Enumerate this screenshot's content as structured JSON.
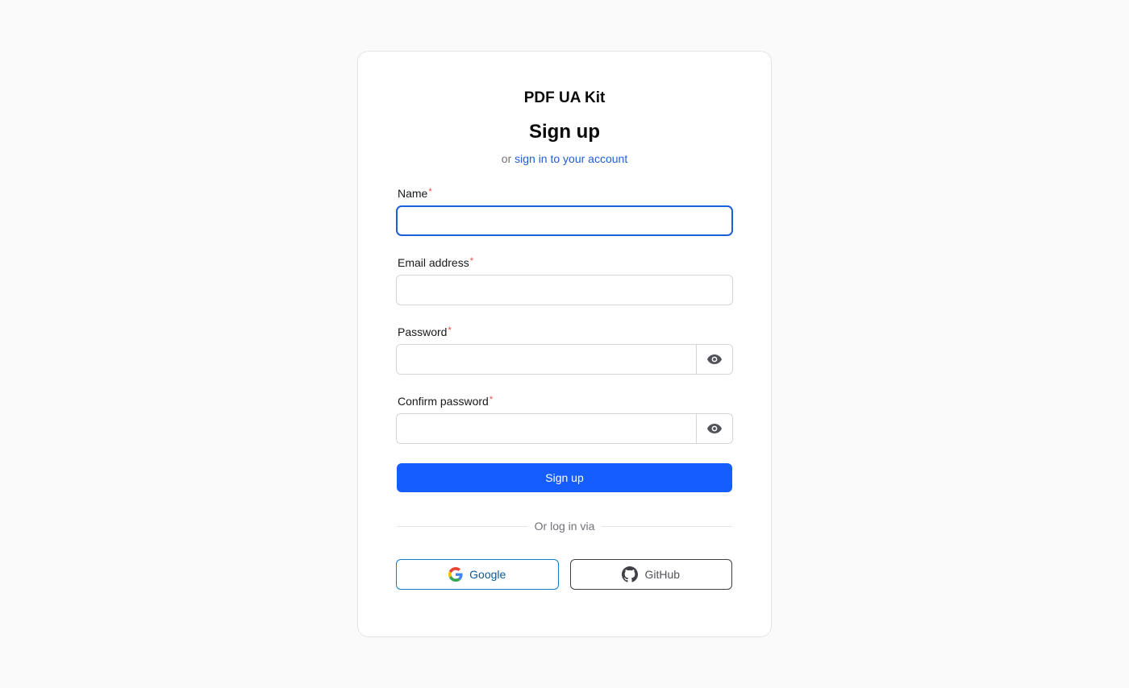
{
  "brand": "PDF UA Kit",
  "title": "Sign up",
  "subtitle": {
    "prefix": "or",
    "link": "sign in to your account"
  },
  "fields": {
    "name": {
      "label": "Name",
      "required_mark": "*",
      "value": ""
    },
    "email": {
      "label": "Email address",
      "required_mark": "*",
      "value": ""
    },
    "password": {
      "label": "Password",
      "required_mark": "*",
      "value": ""
    },
    "confirm_password": {
      "label": "Confirm password",
      "required_mark": "*",
      "value": ""
    }
  },
  "submit_label": "Sign up",
  "divider_text": "Or log in via",
  "social": {
    "google": "Google",
    "github": "GitHub"
  },
  "icons": {
    "password_toggle": "eye-icon",
    "confirm_toggle": "eye-icon",
    "google": "google-icon",
    "github": "github-icon"
  },
  "colors": {
    "accent": "#155dfc",
    "link": "#1d5fd8",
    "required": "#ef4444"
  }
}
